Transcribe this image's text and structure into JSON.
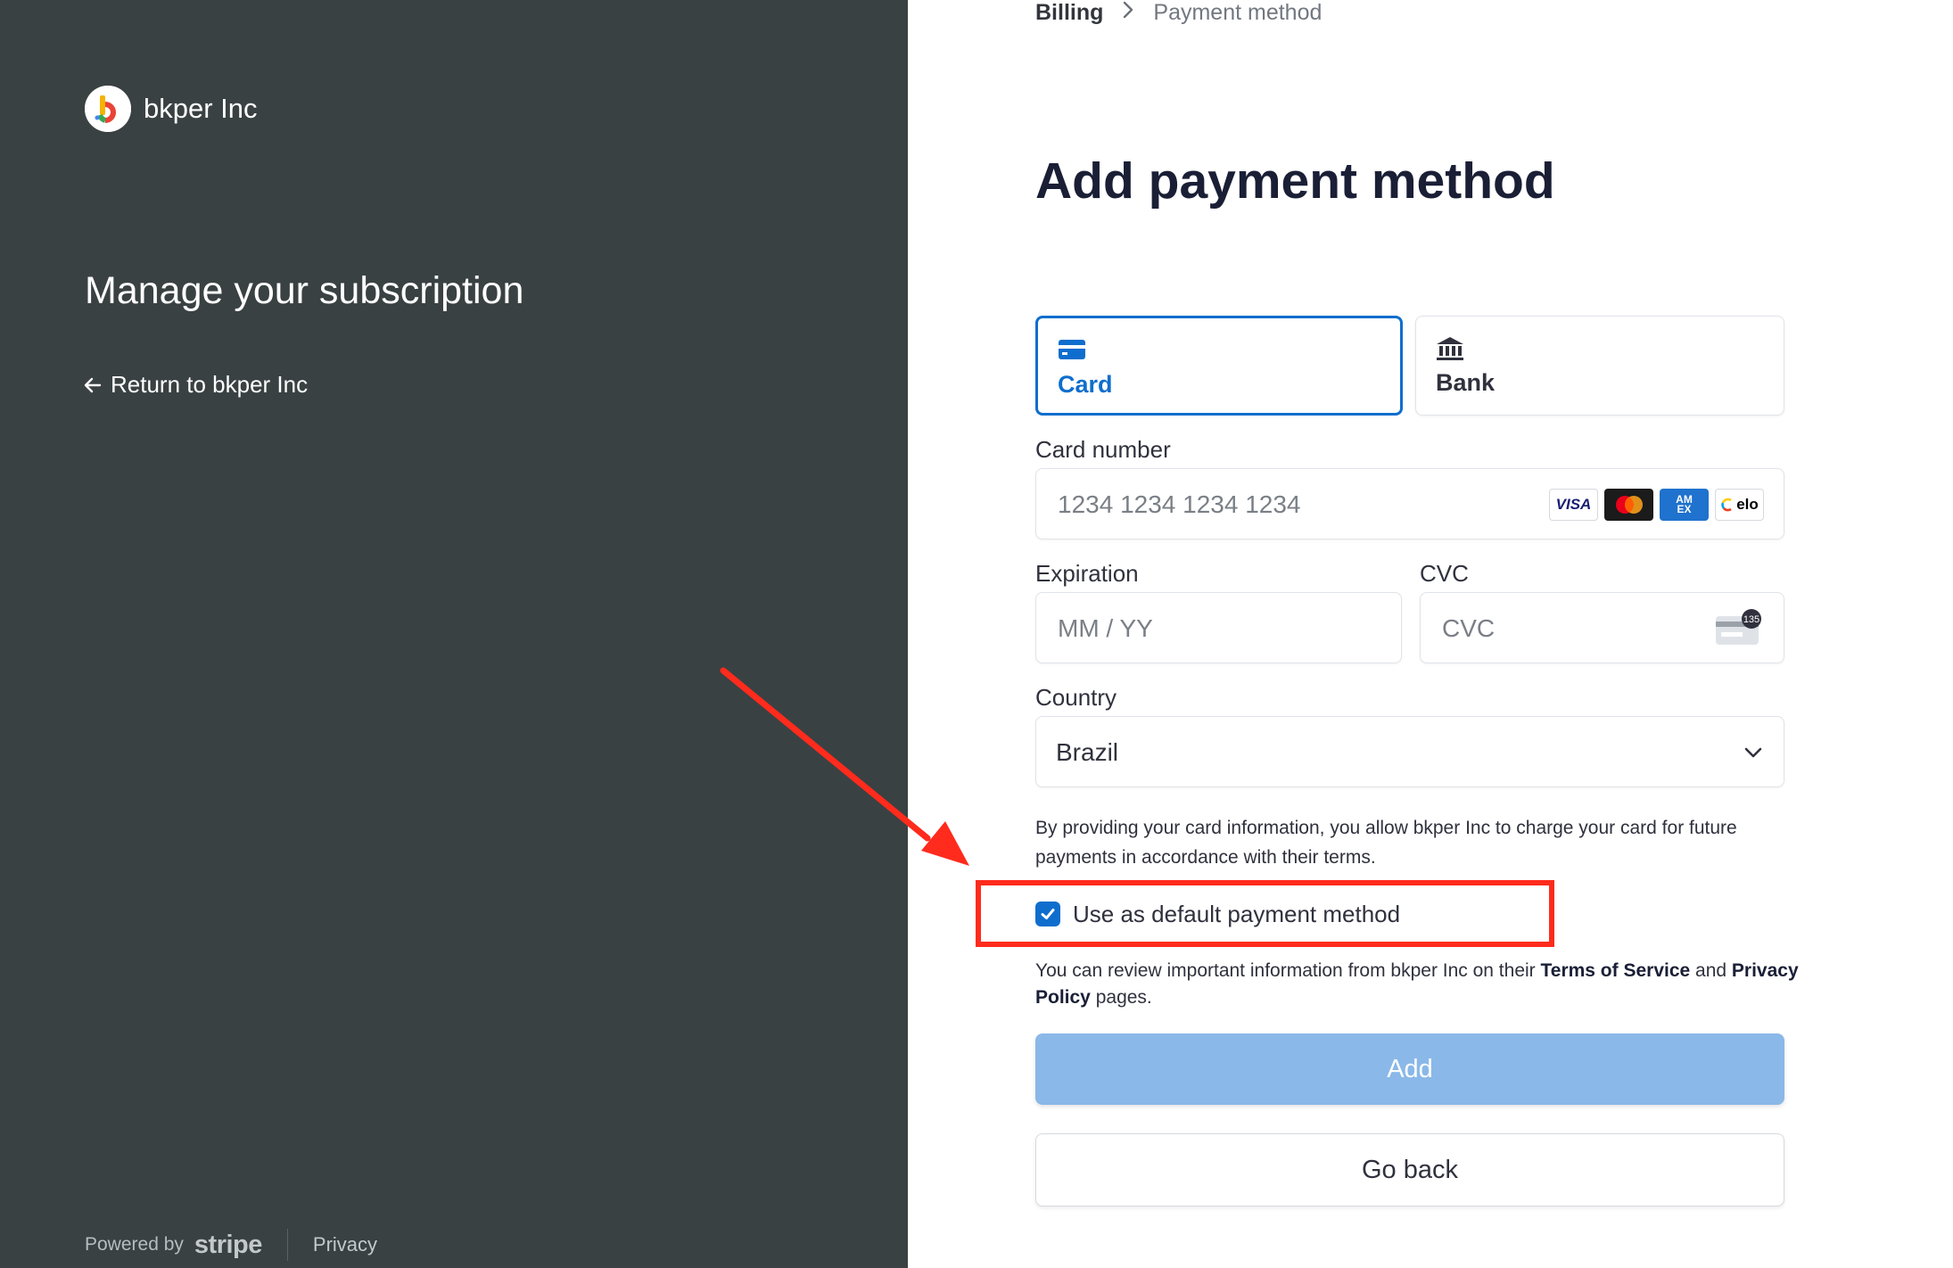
{
  "sidebar": {
    "company_name": "bkper Inc",
    "heading": "Manage your subscription",
    "return_link": "Return to bkper Inc",
    "footer": {
      "powered_by": "Powered by",
      "stripe": "stripe",
      "privacy": "Privacy"
    }
  },
  "breadcrumb": {
    "items": [
      "Billing",
      "Payment method"
    ]
  },
  "page_title": "Add payment method",
  "tabs": [
    {
      "label": "Card",
      "icon": "credit-card-icon",
      "selected": true
    },
    {
      "label": "Bank",
      "icon": "bank-icon",
      "selected": false
    }
  ],
  "form": {
    "card_number": {
      "label": "Card number",
      "placeholder": "1234 1234 1234 1234",
      "value": ""
    },
    "card_brands": [
      "VISA",
      "Mastercard",
      "AMEX",
      "elo"
    ],
    "expiration": {
      "label": "Expiration",
      "placeholder": "MM / YY",
      "value": ""
    },
    "cvc": {
      "label": "CVC",
      "placeholder": "CVC",
      "value": "",
      "icon_text": "135"
    },
    "country": {
      "label": "Country",
      "value": "Brazil"
    }
  },
  "consent_text": "By providing your card information, you allow bkper Inc to charge your card for future payments in accordance with their terms.",
  "default_checkbox": {
    "label": "Use as default payment method",
    "checked": true
  },
  "info": {
    "prefix": "You can review important information from bkper Inc on their ",
    "terms": "Terms of Service",
    "middle": " and ",
    "privacy": "Privacy Policy",
    "suffix": " pages."
  },
  "buttons": {
    "add": "Add",
    "go_back": "Go back"
  },
  "colors": {
    "sidebar_bg": "#3a4143",
    "accent": "#0f6ecd",
    "add_button": "#8ab8e8",
    "annotation": "#ff2b1d"
  }
}
